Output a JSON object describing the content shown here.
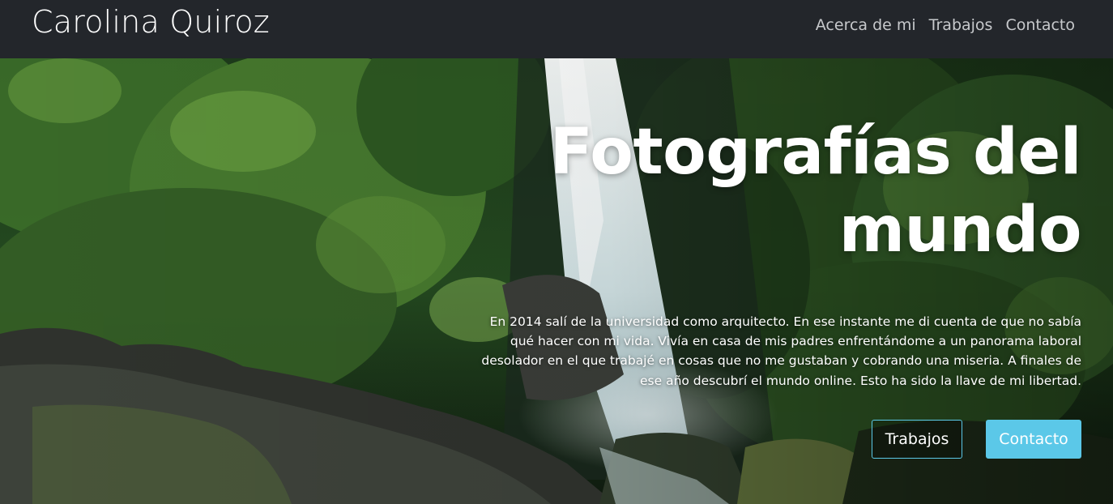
{
  "navbar": {
    "brand": "Carolina Quiroz",
    "links": [
      "Acerca de mi",
      "Trabajos",
      "Contacto"
    ]
  },
  "hero": {
    "title_line1": "Fotografías del",
    "title_line2": "mundo",
    "description": "En 2014 salí de la universidad como arquitecto. En ese instante me di cuenta de que no sabía qué hacer con mi vida. Vivía en casa de mis padres enfrentándome a un panorama laboral desolador en el que trabajé en cosas que no me gustaban y cobrando una miseria. A finales de ese año descubrí el mundo online. Esto ha sido la llave de mi libertad.",
    "buttons": {
      "secondary": "Trabajos",
      "primary": "Contacto"
    }
  },
  "colors": {
    "navbar_bg": "#23262b",
    "accent": "#5bc8e8"
  }
}
